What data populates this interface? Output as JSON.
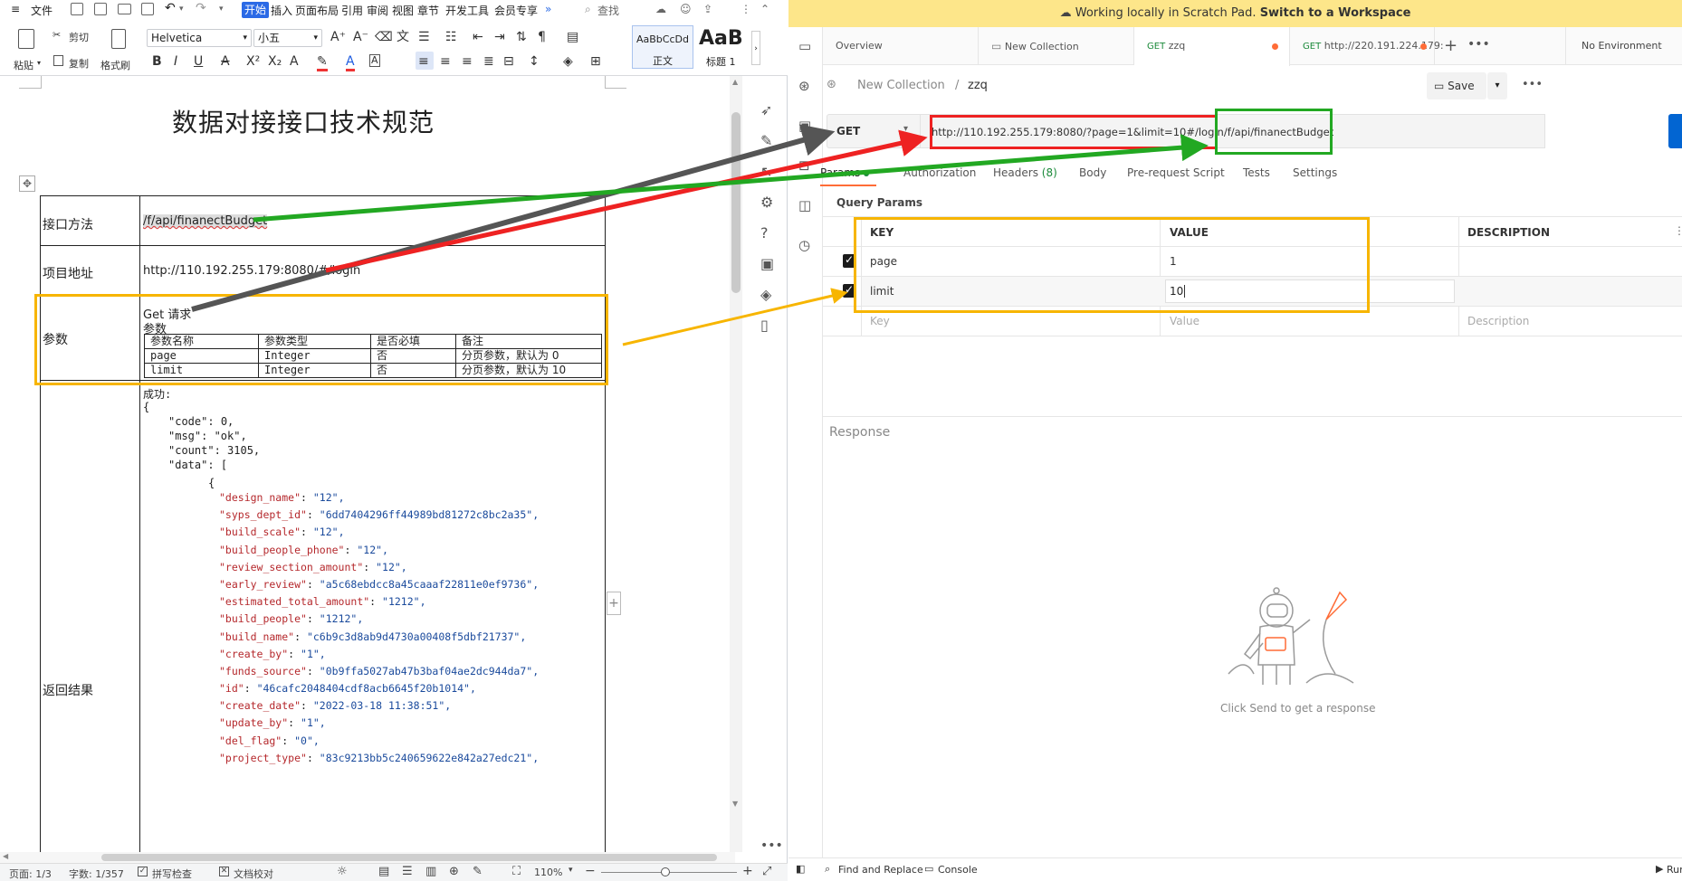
{
  "wps": {
    "menu": {
      "file": "文件",
      "start": "开始",
      "items": [
        "插入",
        "页面布局",
        "引用",
        "审阅",
        "视图",
        "章节",
        "开发工具",
        "会员专享"
      ],
      "search": "查找"
    },
    "ribbon": {
      "paste": "粘贴",
      "cut": "剪切",
      "copy": "复制",
      "format_painter": "格式刷",
      "font_name": "Helvetica",
      "font_size": "小五",
      "style_normal_preview": "AaBbCcDd",
      "style_normal_label": "正文",
      "style_h1_preview": "AaB",
      "style_h1_label": "标题 1"
    },
    "doc": {
      "title": "数据对接接口技术规范",
      "rows": {
        "method_label": "接口方法",
        "method_value": "/f/api/finanectBudget",
        "address_label": "项目地址",
        "address_value": "http://110.192.255.179:8080/#/login",
        "params_label": "参数",
        "params_line1": "Get 请求",
        "params_line2": "参数",
        "return_label": "返回结果"
      },
      "param_table": {
        "headers": [
          "参数名称",
          "参数类型",
          "是否必填",
          "备注"
        ],
        "rows": [
          [
            "page",
            "Integer",
            "否",
            "分页参数，默认为 0"
          ],
          [
            "limit",
            "Integer",
            "否",
            "分页参数，默认为 10"
          ]
        ]
      },
      "result": {
        "success": "成功:",
        "open_brace": "{",
        "top": [
          {
            "k": "\"code\"",
            "v": "0,"
          },
          {
            "k": "\"msg\"",
            "v": "\"ok\","
          },
          {
            "k": "\"count\"",
            "v": "3105,"
          },
          {
            "k": "\"data\"",
            "v": "["
          }
        ],
        "item_brace": "{",
        "items": [
          {
            "k": "\"design_name\"",
            "v": "\"12\","
          },
          {
            "k": "\"syps_dept_id\"",
            "v": "\"6dd7404296ff44989bd81272c8bc2a35\","
          },
          {
            "k": "\"build_scale\"",
            "v": "\"12\","
          },
          {
            "k": "\"build_people_phone\"",
            "v": "\"12\","
          },
          {
            "k": "\"review_section_amount\"",
            "v": "\"12\","
          },
          {
            "k": "\"early_review\"",
            "v": "\"a5c68ebdcc8a45caaaf22811e0ef9736\","
          },
          {
            "k": "\"estimated_total_amount\"",
            "v": "\"1212\","
          },
          {
            "k": "\"build_people\"",
            "v": "\"1212\","
          },
          {
            "k": "\"build_name\"",
            "v": "\"c6b9c3d8ab9d4730a00408f5dbf21737\","
          },
          {
            "k": "\"create_by\"",
            "v": "\"1\","
          },
          {
            "k": "\"funds_source\"",
            "v": "\"0b9ffa5027ab47b3baf04ae2dc944da7\","
          },
          {
            "k": "\"id\"",
            "v": "\"46cafc2048404cdf8acb6645f20b1014\","
          },
          {
            "k": "\"create_date\"",
            "v": "\"2022-03-18 11:38:51\","
          },
          {
            "k": "\"update_by\"",
            "v": "\"1\","
          },
          {
            "k": "\"del_flag\"",
            "v": "\"0\","
          },
          {
            "k": "\"project_type\"",
            "v": "\"83c9213bb5c240659622e842a27edc21\","
          }
        ]
      }
    },
    "status": {
      "page": "页面: 1/3",
      "words": "字数: 1/357",
      "spell": "拼写检查",
      "proof": "文档校对",
      "zoom": "110%"
    }
  },
  "postman": {
    "banner_text": "Working locally in Scratch Pad.",
    "banner_link": "Switch to a Workspace",
    "tabs": {
      "overview": "Overview",
      "new_collection": "New Collection",
      "zzq_method": "GET",
      "zzq": "zzq",
      "url_method": "GET",
      "url_tab": "http://220.191.224.179:",
      "environment": "No Environment"
    },
    "breadcrumb": {
      "collection": "New Collection",
      "sep": "/",
      "request": "zzq"
    },
    "save": "Save",
    "method": "GET",
    "url": "http://110.192.255.179:8080/?page=1&limit=10#/login/f/api/finanectBudget",
    "subtabs": {
      "params": "Params",
      "authorization": "Authorization",
      "headers": "Headers",
      "headers_count": "(8)",
      "body": "Body",
      "prerequest": "Pre-request Script",
      "tests": "Tests",
      "settings": "Settings"
    },
    "query_params_title": "Query Params",
    "columns": {
      "key": "KEY",
      "value": "VALUE",
      "description": "DESCRIPTION"
    },
    "params": [
      {
        "key": "page",
        "value": "1"
      },
      {
        "key": "limit",
        "value": "10"
      }
    ],
    "placeholders": {
      "key": "Key",
      "value": "Value",
      "description": "Description"
    },
    "response_label": "Response",
    "empty_hint": "Click Send to get a response",
    "bottom": {
      "find": "Find and Replace",
      "console": "Console",
      "run": "Run"
    }
  },
  "colors": {
    "arrow_dark": "#555555",
    "arrow_red": "#ee2222",
    "arrow_green": "#22a822",
    "arrow_yellow": "#f7b500",
    "banner": "#fde68a",
    "wps_accent": "#2b6ae6"
  }
}
